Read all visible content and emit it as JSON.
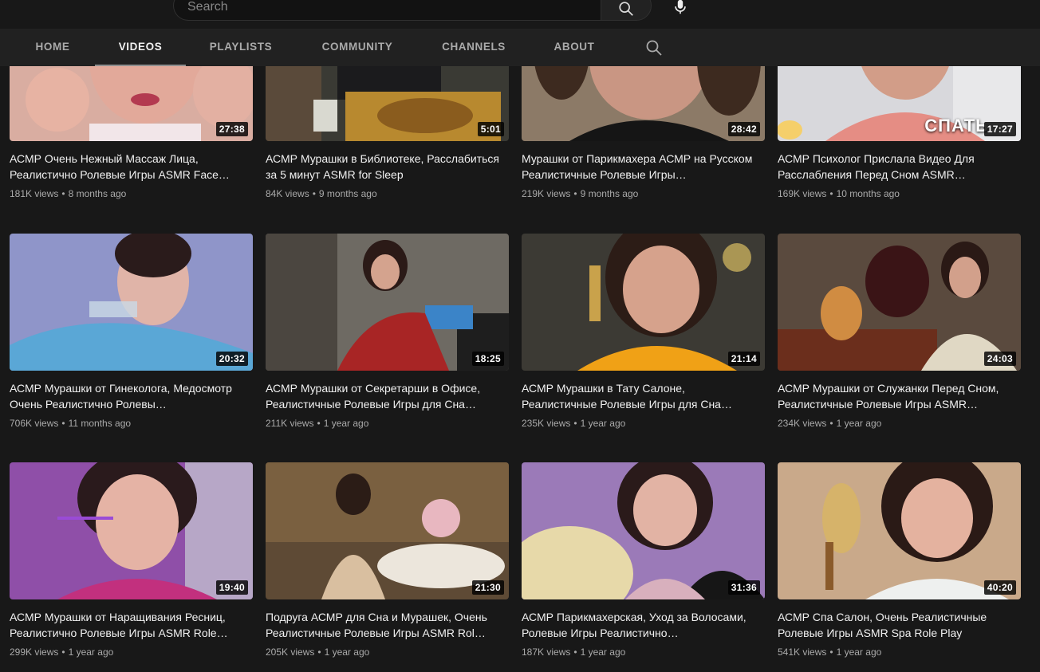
{
  "search": {
    "placeholder": "Search"
  },
  "tabs": [
    {
      "label": "HOME",
      "active": false
    },
    {
      "label": "VIDEOS",
      "active": true
    },
    {
      "label": "PLAYLISTS",
      "active": false
    },
    {
      "label": "COMMUNITY",
      "active": false
    },
    {
      "label": "CHANNELS",
      "active": false
    },
    {
      "label": "ABOUT",
      "active": false
    }
  ],
  "videos": [
    {
      "title": "АСМР Очень Нежный Массаж Лица, Реалистично Ролевые Игры ASMR Face…",
      "views": "181K views",
      "age": "8 months ago",
      "duration": "27:38"
    },
    {
      "title": "АСМР Мурашки в Библиотеке, Расслабиться за 5 минут ASMR for Sleep",
      "views": "84K views",
      "age": "9 months ago",
      "duration": "5:01"
    },
    {
      "title": "Мурашки от Парикмахера АСМР на Русском Реалистичные Ролевые Игры…",
      "views": "219K views",
      "age": "9 months ago",
      "duration": "28:42"
    },
    {
      "title": "АСМР Психолог Прислала Видео Для Расслабления Перед Сном ASMR…",
      "views": "169K views",
      "age": "10 months ago",
      "duration": "17:27",
      "overlay": "СПАТЬ"
    },
    {
      "title": "АСМР Мурашки от Гинеколога, Медосмотр Очень Реалистично Ролевы…",
      "views": "706K views",
      "age": "11 months ago",
      "duration": "20:32"
    },
    {
      "title": "АСМР Мурашки от Секретарши в Офисе, Реалистичные Ролевые Игры для Сна…",
      "views": "211K views",
      "age": "1 year ago",
      "duration": "18:25"
    },
    {
      "title": "АСМР Мурашки в Тату Салоне, Реалистичные Ролевые Игры для Сна…",
      "views": "235K views",
      "age": "1 year ago",
      "duration": "21:14"
    },
    {
      "title": "АСМР Мурашки от Служанки Перед Сном, Реалистичные Ролевые Игры ASMR…",
      "views": "234K views",
      "age": "1 year ago",
      "duration": "24:03"
    },
    {
      "title": "АСМР Мурашки от Наращивания Ресниц, Реалистично Ролевые Игры ASMR Role…",
      "views": "299K views",
      "age": "1 year ago",
      "duration": "19:40"
    },
    {
      "title": "Подруга АСМР для Сна и Мурашек, Очень Реалистичные Ролевые Игры ASMR Rol…",
      "views": "205K views",
      "age": "1 year ago",
      "duration": "21:30"
    },
    {
      "title": "АСМР Парикмахерская, Уход за Волосами, Ролевые Игры Реалистично…",
      "views": "187K views",
      "age": "1 year ago",
      "duration": "31:36"
    },
    {
      "title": "АСМР Спа Салон, Очень Реалистичные Ролевые Игры ASMR Spa Role Play",
      "views": "541K views",
      "age": "1 year ago",
      "duration": "40:20"
    }
  ],
  "colors": {
    "background": "#181818",
    "tabs_bar": "#212121",
    "text": "#f1f1f1",
    "muted": "#aaaaaa"
  },
  "icons": {
    "search": "search-icon",
    "mic": "microphone-icon",
    "tab_search": "search-icon"
  }
}
